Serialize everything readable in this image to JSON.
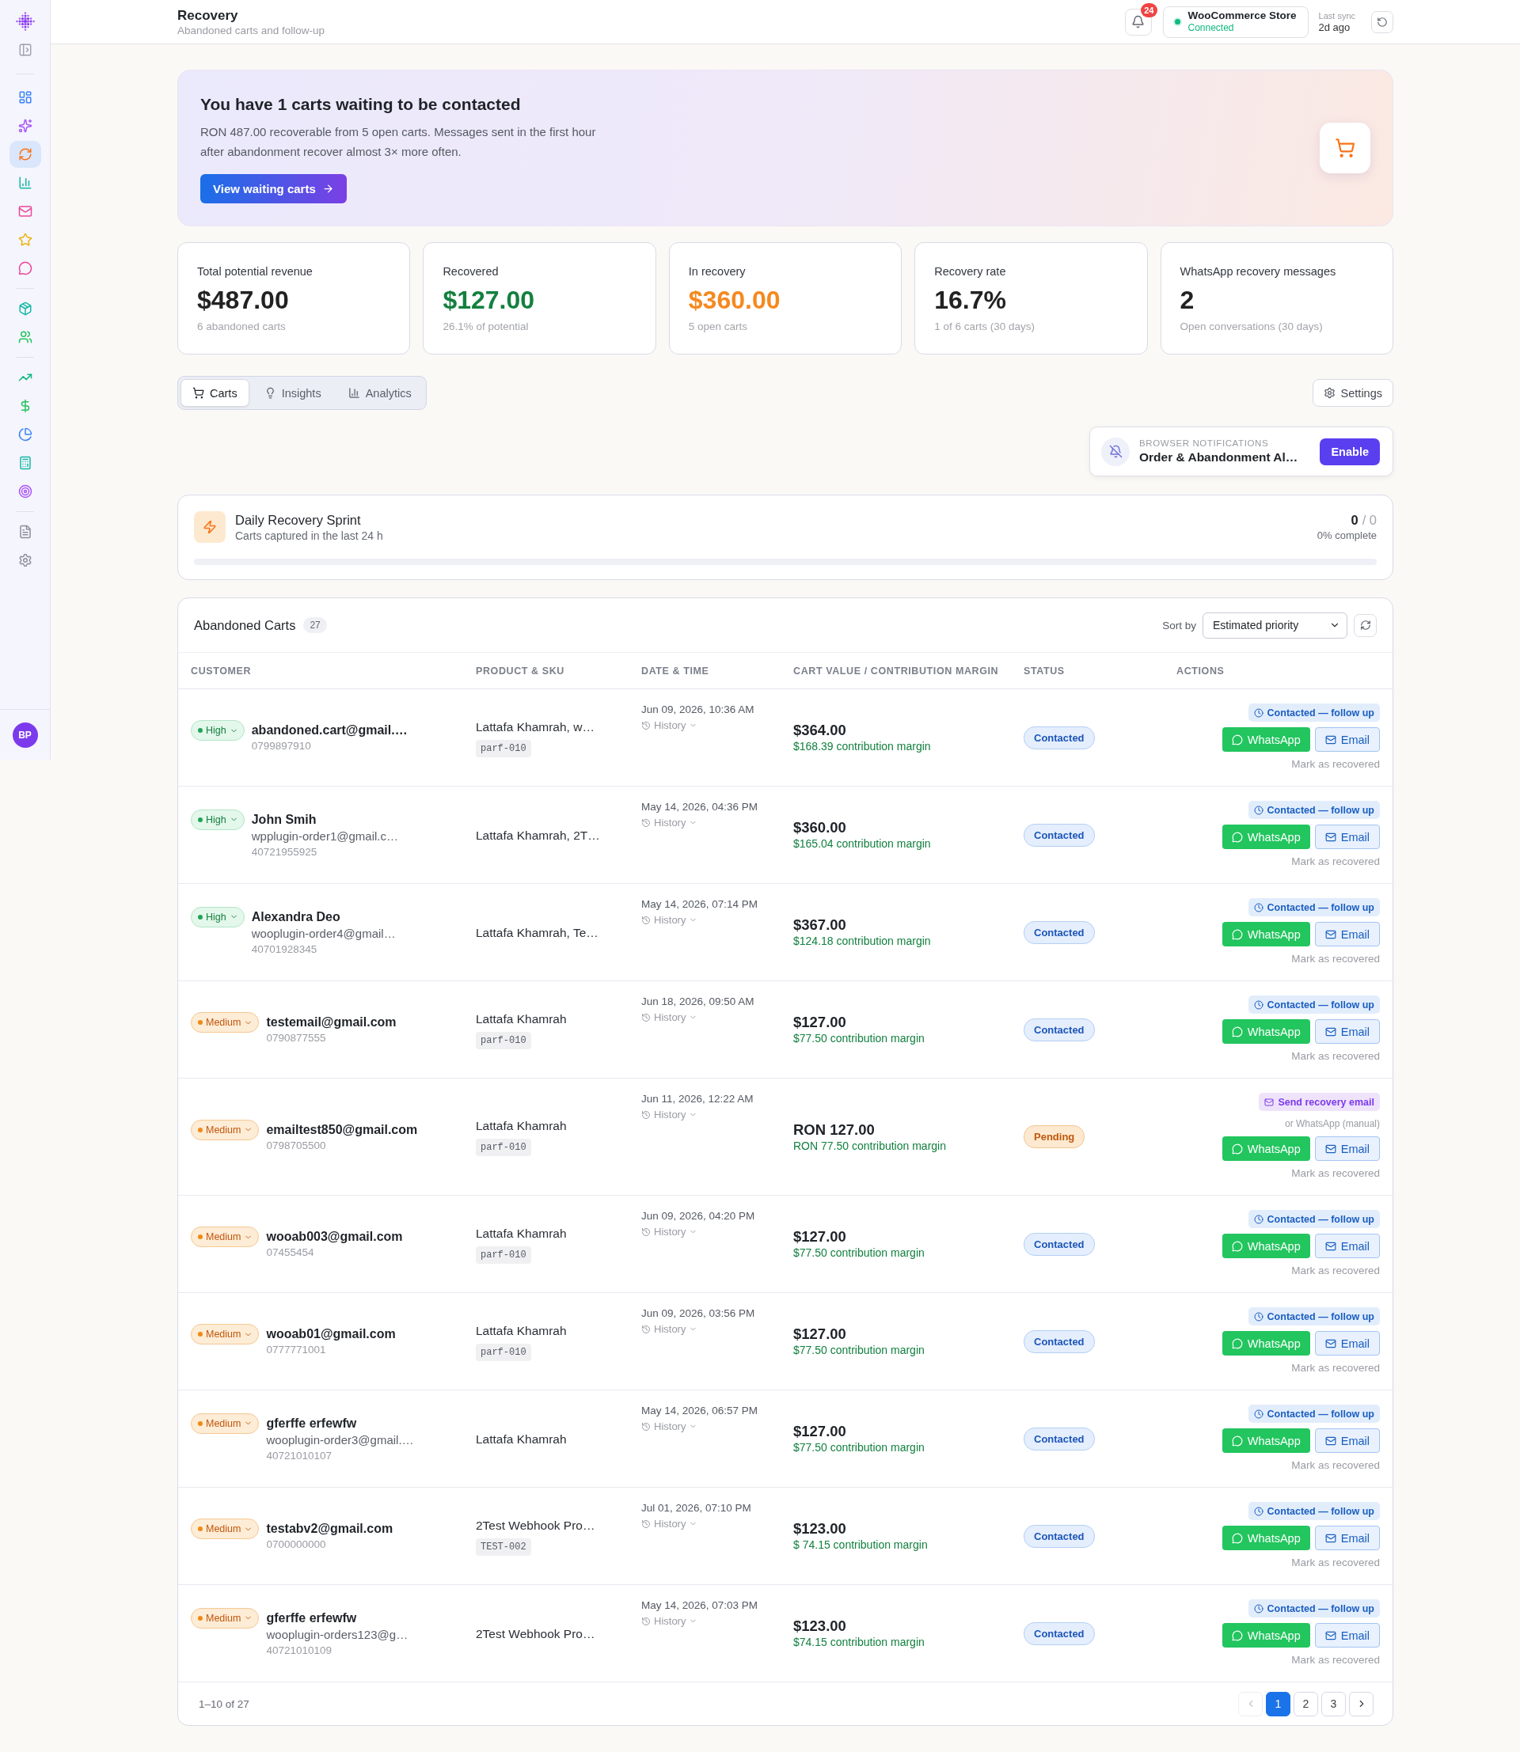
{
  "sidebar": {
    "groups": [
      {
        "items": [
          {
            "selected": false
          },
          {
            "selected": false
          },
          {
            "selected": true
          },
          {
            "selected": false
          },
          {
            "selected": false
          },
          {
            "selected": false
          },
          {
            "selected": false
          }
        ]
      },
      {
        "items": [
          {
            "selected": false
          },
          {
            "selected": false
          }
        ]
      },
      {
        "items": [
          {
            "selected": false
          },
          {
            "selected": false
          },
          {
            "selected": false
          },
          {
            "selected": false
          },
          {
            "selected": false
          }
        ]
      },
      {
        "items": [
          {
            "selected": false
          },
          {
            "selected": false
          }
        ]
      }
    ],
    "avatar": "BP"
  },
  "header": {
    "title": "Recovery",
    "subtitle": "Abandoned carts and follow-up",
    "notification_count": "24",
    "store": {
      "name": "WooCommerce Store",
      "status": "Connected",
      "connected": true
    },
    "sync": {
      "label": "Last sync",
      "value": "2d ago"
    }
  },
  "banner": {
    "title": "You have 1 carts waiting to be contacted",
    "text": "RON 487.00 recoverable from 5 open carts. Messages sent in the first hour after abandonment recover almost 3× more often.",
    "button": "View waiting carts"
  },
  "stats": [
    {
      "label": "Total potential revenue",
      "value": "$487.00",
      "note": "6 abandoned carts",
      "color": "#222222"
    },
    {
      "label": "Recovered",
      "value": "$127.00",
      "note": "26.1% of potential",
      "color": "#13803f"
    },
    {
      "label": "In recovery",
      "value": "$360.00",
      "note": "5 open carts",
      "color": "#f5891f"
    },
    {
      "label": "Recovery rate",
      "value": "16.7%",
      "note": "1 of 6 carts (30 days)",
      "color": "#222222"
    },
    {
      "label": "WhatsApp recovery messages",
      "value": "2",
      "note": "Open conversations (30 days)",
      "color": "#222222"
    }
  ],
  "tabs": {
    "items": [
      {
        "label": "Carts",
        "selected": true
      },
      {
        "label": "Insights",
        "selected": false
      },
      {
        "label": "Analytics",
        "selected": false
      }
    ],
    "settings": "Settings"
  },
  "browser_notifications": {
    "label": "BROWSER NOTIFICATIONS",
    "title": "Order & Abandonment Al…",
    "button": "Enable"
  },
  "sprint": {
    "title": "Daily Recovery Sprint",
    "subtitle": "Carts captured in the last 24 h",
    "done": "0",
    "total": "/ 0",
    "status": "0% complete"
  },
  "carts_table": {
    "title": "Abandoned Carts",
    "count": "27",
    "sort_label": "Sort by",
    "sort_value": "Estimated priority",
    "columns": [
      "CUSTOMER",
      "PRODUCT & SKU",
      "DATE & TIME",
      "CART VALUE / CONTRIBUTION MARGIN",
      "STATUS",
      "ACTIONS"
    ],
    "rows": [
      {
        "priority": {
          "label": "High",
          "kind": "high"
        },
        "customer": {
          "name": "abandoned.cart@gmail.…",
          "phone": "0799897910"
        },
        "product": {
          "name": "Lattafa Khamrah, w…",
          "sku": "parf-010"
        },
        "date": "Jun 09, 2026, 10:36 AM",
        "history": "History",
        "value": "$364.00",
        "margin": "$168.39 contribution margin",
        "status": {
          "label": "Contacted",
          "kind": "contacted"
        },
        "action": {
          "label": "Contacted — follow up",
          "kind": "follow_up"
        },
        "whatsapp": "WhatsApp",
        "email": "Email",
        "mark": "Mark as recovered"
      },
      {
        "priority": {
          "label": "High",
          "kind": "high"
        },
        "customer": {
          "name": "John Smih",
          "email": "wpplugin-order1@gmail.c…",
          "phone": "40721955925"
        },
        "product": {
          "name": "Lattafa Khamrah, 2T…"
        },
        "date": "May 14, 2026, 04:36 PM",
        "history": "History",
        "value": "$360.00",
        "margin": "$165.04 contribution margin",
        "status": {
          "label": "Contacted",
          "kind": "contacted"
        },
        "action": {
          "label": "Contacted — follow up",
          "kind": "follow_up"
        },
        "whatsapp": "WhatsApp",
        "email": "Email",
        "mark": "Mark as recovered"
      },
      {
        "priority": {
          "label": "High",
          "kind": "high"
        },
        "customer": {
          "name": "Alexandra Deo",
          "email": "wooplugin-order4@gmail…",
          "phone": "40701928345"
        },
        "product": {
          "name": "Lattafa Khamrah, Te…"
        },
        "date": "May 14, 2026, 07:14 PM",
        "history": "History",
        "value": "$367.00",
        "margin": "$124.18 contribution margin",
        "status": {
          "label": "Contacted",
          "kind": "contacted"
        },
        "action": {
          "label": "Contacted — follow up",
          "kind": "follow_up"
        },
        "whatsapp": "WhatsApp",
        "email": "Email",
        "mark": "Mark as recovered"
      },
      {
        "priority": {
          "label": "Medium",
          "kind": "medium"
        },
        "customer": {
          "name": "testemail@gmail.com",
          "phone": "0790877555"
        },
        "product": {
          "name": "Lattafa Khamrah",
          "sku": "parf-010"
        },
        "date": "Jun 18, 2026, 09:50 AM",
        "history": "History",
        "value": "$127.00",
        "margin": "$77.50 contribution margin",
        "status": {
          "label": "Contacted",
          "kind": "contacted"
        },
        "action": {
          "label": "Contacted — follow up",
          "kind": "follow_up"
        },
        "whatsapp": "WhatsApp",
        "email": "Email",
        "mark": "Mark as recovered"
      },
      {
        "priority": {
          "label": "Medium",
          "kind": "medium"
        },
        "customer": {
          "name": "emailtest850@gmail.com",
          "phone": "0798705500"
        },
        "product": {
          "name": "Lattafa Khamrah",
          "sku": "parf-010"
        },
        "date": "Jun 11, 2026, 12:22 AM",
        "history": "History",
        "value": "RON 127.00",
        "margin": "RON 77.50 contribution margin",
        "status": {
          "label": "Pending",
          "kind": "pending"
        },
        "action": {
          "label": "Send recovery email",
          "kind": "send_email"
        },
        "note": "or WhatsApp (manual)",
        "whatsapp": "WhatsApp",
        "email": "Email",
        "mark": "Mark as recovered"
      },
      {
        "priority": {
          "label": "Medium",
          "kind": "medium"
        },
        "customer": {
          "name": "wooab003@gmail.com",
          "phone": "07455454"
        },
        "product": {
          "name": "Lattafa Khamrah",
          "sku": "parf-010"
        },
        "date": "Jun 09, 2026, 04:20 PM",
        "history": "History",
        "value": "$127.00",
        "margin": "$77.50 contribution margin",
        "status": {
          "label": "Contacted",
          "kind": "contacted"
        },
        "action": {
          "label": "Contacted — follow up",
          "kind": "follow_up"
        },
        "whatsapp": "WhatsApp",
        "email": "Email",
        "mark": "Mark as recovered"
      },
      {
        "priority": {
          "label": "Medium",
          "kind": "medium"
        },
        "customer": {
          "name": "wooab01@gmail.com",
          "phone": "0777771001"
        },
        "product": {
          "name": "Lattafa Khamrah",
          "sku": "parf-010"
        },
        "date": "Jun 09, 2026, 03:56 PM",
        "history": "History",
        "value": "$127.00",
        "margin": "$77.50 contribution margin",
        "status": {
          "label": "Contacted",
          "kind": "contacted"
        },
        "action": {
          "label": "Contacted — follow up",
          "kind": "follow_up"
        },
        "whatsapp": "WhatsApp",
        "email": "Email",
        "mark": "Mark as recovered"
      },
      {
        "priority": {
          "label": "Medium",
          "kind": "medium"
        },
        "customer": {
          "name": "gferffe erfewfw",
          "email": "wooplugin-order3@gmail.…",
          "phone": "40721010107"
        },
        "product": {
          "name": "Lattafa Khamrah"
        },
        "date": "May 14, 2026, 06:57 PM",
        "history": "History",
        "value": "$127.00",
        "margin": "$77.50 contribution margin",
        "status": {
          "label": "Contacted",
          "kind": "contacted"
        },
        "action": {
          "label": "Contacted — follow up",
          "kind": "follow_up"
        },
        "whatsapp": "WhatsApp",
        "email": "Email",
        "mark": "Mark as recovered"
      },
      {
        "priority": {
          "label": "Medium",
          "kind": "medium"
        },
        "customer": {
          "name": "testabv2@gmail.com",
          "phone": "0700000000"
        },
        "product": {
          "name": "2Test Webhook Pro…",
          "sku": "TEST-002"
        },
        "date": "Jul 01, 2026, 07:10 PM",
        "history": "History",
        "value": "$123.00",
        "margin": "$ 74.15 contribution margin",
        "status": {
          "label": "Contacted",
          "kind": "contacted"
        },
        "action": {
          "label": "Contacted — follow up",
          "kind": "follow_up"
        },
        "whatsapp": "WhatsApp",
        "email": "Email",
        "mark": "Mark as recovered"
      },
      {
        "priority": {
          "label": "Medium",
          "kind": "medium"
        },
        "customer": {
          "name": "gferffe erfewfw",
          "email": "wooplugin-orders123@g…",
          "phone": "40721010109"
        },
        "product": {
          "name": "2Test Webhook Pro…"
        },
        "date": "May 14, 2026, 07:03 PM",
        "history": "History",
        "value": "$123.00",
        "margin": "$74.15 contribution margin",
        "status": {
          "label": "Contacted",
          "kind": "contacted"
        },
        "action": {
          "label": "Contacted — follow up",
          "kind": "follow_up"
        },
        "whatsapp": "WhatsApp",
        "email": "Email",
        "mark": "Mark as recovered"
      }
    ],
    "footer": {
      "range": "1–10 of 27",
      "previous": {
        "disabled": true
      },
      "pages": [
        {
          "label": "1",
          "selected": true
        },
        {
          "label": "2",
          "selected": false
        },
        {
          "label": "3",
          "selected": false
        }
      ],
      "next": {
        "disabled": false
      }
    }
  }
}
